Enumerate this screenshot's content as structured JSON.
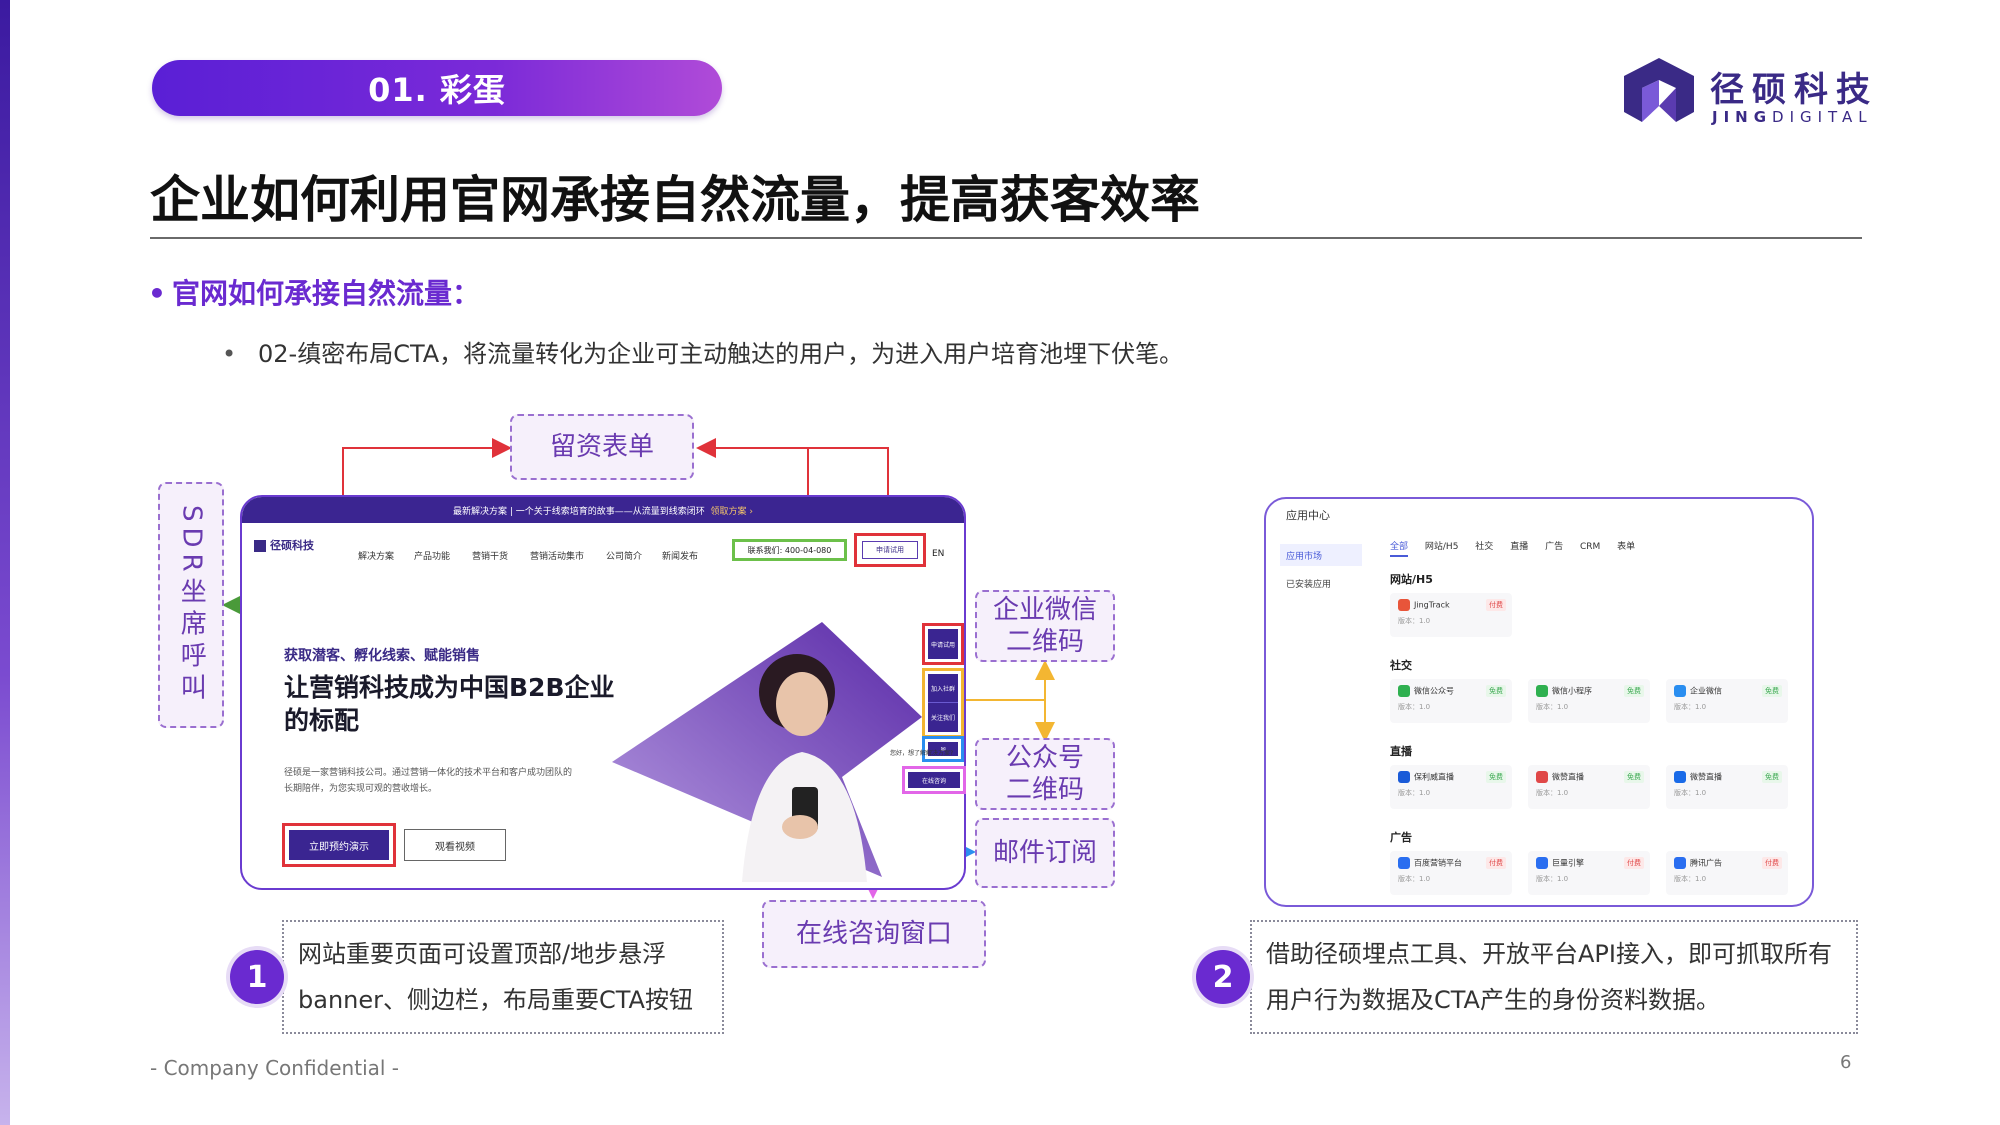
{
  "section_label": "01. 彩蛋",
  "brand": {
    "cn": "径硕科技",
    "en_bold": "JING",
    "en_rest": "DIGITAL"
  },
  "title": "企业如何利用官网承接自然流量，提高获客效率",
  "bullet_main": "官网如何承接自然流量：",
  "bullet_sub": "02-缜密布局CTA，将流量转化为企业可主动触达的用户，为进入用户培育池埋下伏笔。",
  "labels": {
    "form": "留资表单",
    "sdr": "SDR坐席呼叫",
    "wecom_qr": "企业微信\n二维码",
    "mp_qr": "公众号\n二维码",
    "email": "邮件订阅",
    "chat": "在线咨询窗口"
  },
  "website": {
    "topbar": "最新解决方案 | 一个关于线索培育的故事——从流量到线索闭环",
    "topbar_link": "领取方案 ›",
    "logo": "径硕科技",
    "nav": [
      "解决方案",
      "产品功能",
      "营销干货",
      "营销活动集市",
      "公司简介",
      "新闻发布"
    ],
    "contact": "联系我们: 400-04-080",
    "trial": "申请试用",
    "lang": "EN",
    "hero_tag": "获取潜客、孵化线索、赋能销售",
    "hero_title": "让营销科技成为中国B2B企业的标配",
    "hero_desc": "径硕是一家营销科技公司。通过营销一体化的技术平台和客户成功团队的长期陪伴，为您实现可观的营收增长。",
    "btn_demo": "立即预约演示",
    "btn_video": "观看视频",
    "side_trial": "申请试用",
    "side_community": "加入社群",
    "side_follow": "关注我们",
    "side_chat": "在线咨询",
    "float_tag": "您好，想了解解决方案?"
  },
  "app_center": {
    "title": "应用中心",
    "sidebar": [
      "应用市场",
      "已安装应用"
    ],
    "tabs": [
      "全部",
      "网站/H5",
      "社交",
      "直播",
      "广告",
      "CRM",
      "表单"
    ],
    "sections": [
      {
        "name": "网站/H5",
        "apps": [
          {
            "name": "JingTrack",
            "ver": "版本：1.0",
            "badge": "付费",
            "paid": true,
            "color": "#e8553a"
          }
        ]
      },
      {
        "name": "社交",
        "apps": [
          {
            "name": "微信公众号",
            "ver": "版本：1.0",
            "badge": "免费",
            "paid": false,
            "color": "#2fb050"
          },
          {
            "name": "微信小程序",
            "ver": "版本：1.0",
            "badge": "免费",
            "paid": false,
            "color": "#2fb050"
          },
          {
            "name": "企业微信",
            "ver": "版本：1.0",
            "badge": "免费",
            "paid": false,
            "color": "#2a8ef0"
          }
        ]
      },
      {
        "name": "直播",
        "apps": [
          {
            "name": "保利威直播",
            "ver": "版本：1.0",
            "badge": "免费",
            "paid": false,
            "color": "#1a5bd8"
          },
          {
            "name": "微赞直播",
            "ver": "版本：1.0",
            "badge": "免费",
            "paid": false,
            "color": "#e04848"
          },
          {
            "name": "微赞直播",
            "ver": "版本：1.0",
            "badge": "免费",
            "paid": false,
            "color": "#1a6be8"
          }
        ]
      },
      {
        "name": "广告",
        "apps": [
          {
            "name": "百度营销平台",
            "ver": "版本：1.0",
            "badge": "付费",
            "paid": true,
            "color": "#2a6ef0"
          },
          {
            "name": "巨量引擎",
            "ver": "版本：1.0",
            "badge": "付费",
            "paid": true,
            "color": "#2a6ef0"
          },
          {
            "name": "腾讯广告",
            "ver": "版本：1.0",
            "badge": "付费",
            "paid": true,
            "color": "#2a6ef0"
          }
        ]
      }
    ]
  },
  "step1": {
    "num": "1",
    "text": "网站重要页面可设置顶部/地步悬浮banner、侧边栏，布局重要CTA按钮"
  },
  "step2": {
    "num": "2",
    "text": "借助径硕埋点工具、开放平台API接入，即可抓取所有用户行为数据及CTA产生的身份资料数据。"
  },
  "footer": {
    "confidential": "- Company Confidential -",
    "page": "6"
  },
  "colors": {
    "accent": "#6a2ad0",
    "red": "#e0323a",
    "green": "#6cc04a",
    "yellow": "#f3b632",
    "blue": "#2a8ef0",
    "pink": "#e266e8"
  }
}
